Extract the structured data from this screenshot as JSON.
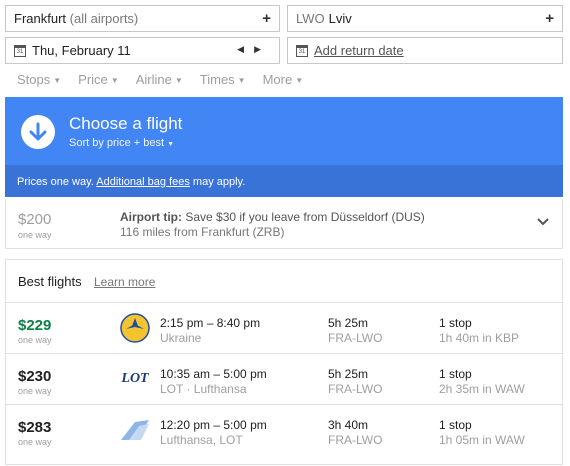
{
  "search": {
    "origin_city": "Frankfurt",
    "origin_detail": "(all airports)",
    "dest_code": "LWO",
    "dest_city": "Lviv",
    "depart_date": "Thu, February 11",
    "return_label": "Add return date",
    "plus": "+",
    "cal_glyph": "31"
  },
  "filters": [
    "Stops",
    "Price",
    "Airline",
    "Times",
    "More"
  ],
  "banner": {
    "title": "Choose a flight",
    "sort": "Sort by price + best",
    "notice_prefix": "Prices one way.",
    "notice_link": "Additional bag fees",
    "notice_suffix": "may apply.",
    "color": "#4285f4"
  },
  "tip": {
    "price": "$200",
    "one_way": "one way",
    "label": "Airport tip:",
    "text": "Save $30 if you leave from Düsseldorf (DUS)",
    "subtext": "116 miles from Frankfurt (ZRB)"
  },
  "best": {
    "heading": "Best flights",
    "learn_more": "Learn more",
    "flights": [
      {
        "price": "$229",
        "one_way": "one way",
        "times": "2:15 pm – 8:40 pm",
        "airline": "Ukraine",
        "duration": "5h 25m",
        "route": "FRA-LWO",
        "stops": "1 stop",
        "layover": "1h 40m in KBP",
        "logo": "ukraine-airlines-logo"
      },
      {
        "price": "$230",
        "one_way": "one way",
        "times": "10:35 am – 5:00 pm",
        "airline": "LOT · Lufthansa",
        "duration": "5h 25m",
        "route": "FRA-LWO",
        "stops": "1 stop",
        "layover": "2h 35m in WAW",
        "logo": "lot-logo",
        "logo_text": "LOT"
      },
      {
        "price": "$283",
        "one_way": "one way",
        "times": "12:20 pm – 5:00 pm",
        "airline": "Lufthansa, LOT",
        "duration": "3h 40m",
        "route": "FRA-LWO",
        "stops": "1 stop",
        "layover": "1h 05m in WAW",
        "logo": "multi-airline-logo"
      }
    ]
  }
}
